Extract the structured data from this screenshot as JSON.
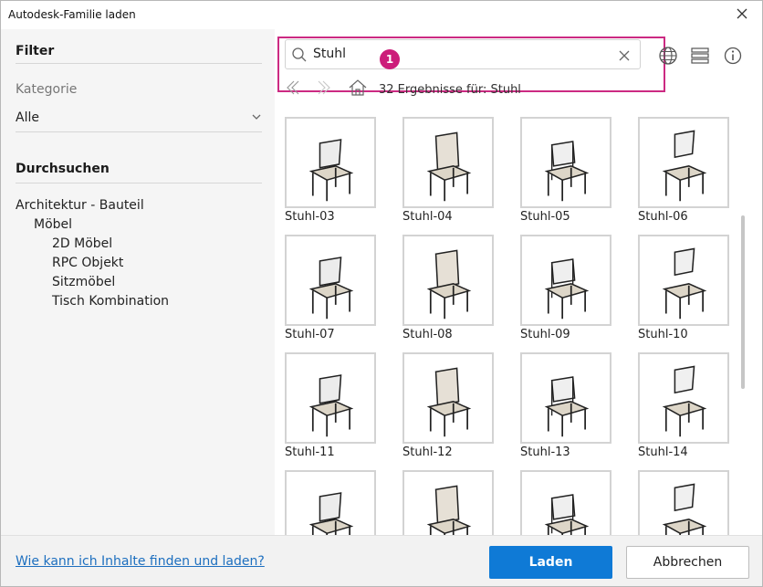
{
  "window": {
    "title": "Autodesk-Familie laden"
  },
  "sidebar": {
    "filter_heading": "Filter",
    "category_label": "Kategorie",
    "category_value": "Alle",
    "browse_heading": "Durchsuchen",
    "tree": [
      {
        "label": "Architektur - Bauteil"
      },
      {
        "label": "Möbel"
      },
      {
        "label": "2D Möbel"
      },
      {
        "label": "RPC Objekt"
      },
      {
        "label": "Sitzmöbel"
      },
      {
        "label": "Tisch Kombination"
      }
    ]
  },
  "search": {
    "value": "Stuhl",
    "callout_number": "1"
  },
  "breadcrumb": {
    "text": "32 Ergebnisse für: Stuhl"
  },
  "results": [
    {
      "name": "Stuhl-03"
    },
    {
      "name": "Stuhl-04"
    },
    {
      "name": "Stuhl-05"
    },
    {
      "name": "Stuhl-06"
    },
    {
      "name": "Stuhl-07"
    },
    {
      "name": "Stuhl-08"
    },
    {
      "name": "Stuhl-09"
    },
    {
      "name": "Stuhl-10"
    },
    {
      "name": "Stuhl-11"
    },
    {
      "name": "Stuhl-12"
    },
    {
      "name": "Stuhl-13"
    },
    {
      "name": "Stuhl-14"
    },
    {
      "name": ""
    },
    {
      "name": ""
    },
    {
      "name": ""
    },
    {
      "name": ""
    }
  ],
  "footer": {
    "help_link": "Wie kann ich Inhalte finden und laden?",
    "load_button": "Laden",
    "cancel_button": "Abbrechen"
  },
  "colors": {
    "accent": "#0f7ad6",
    "callout": "#cc1d7a",
    "link": "#1d6fbf"
  },
  "icons": [
    "close-icon",
    "search-icon",
    "clear-icon",
    "globe-icon",
    "list-view-icon",
    "info-icon",
    "back-icon",
    "forward-icon",
    "home-icon",
    "chevron-down-icon",
    "chair-icon"
  ]
}
